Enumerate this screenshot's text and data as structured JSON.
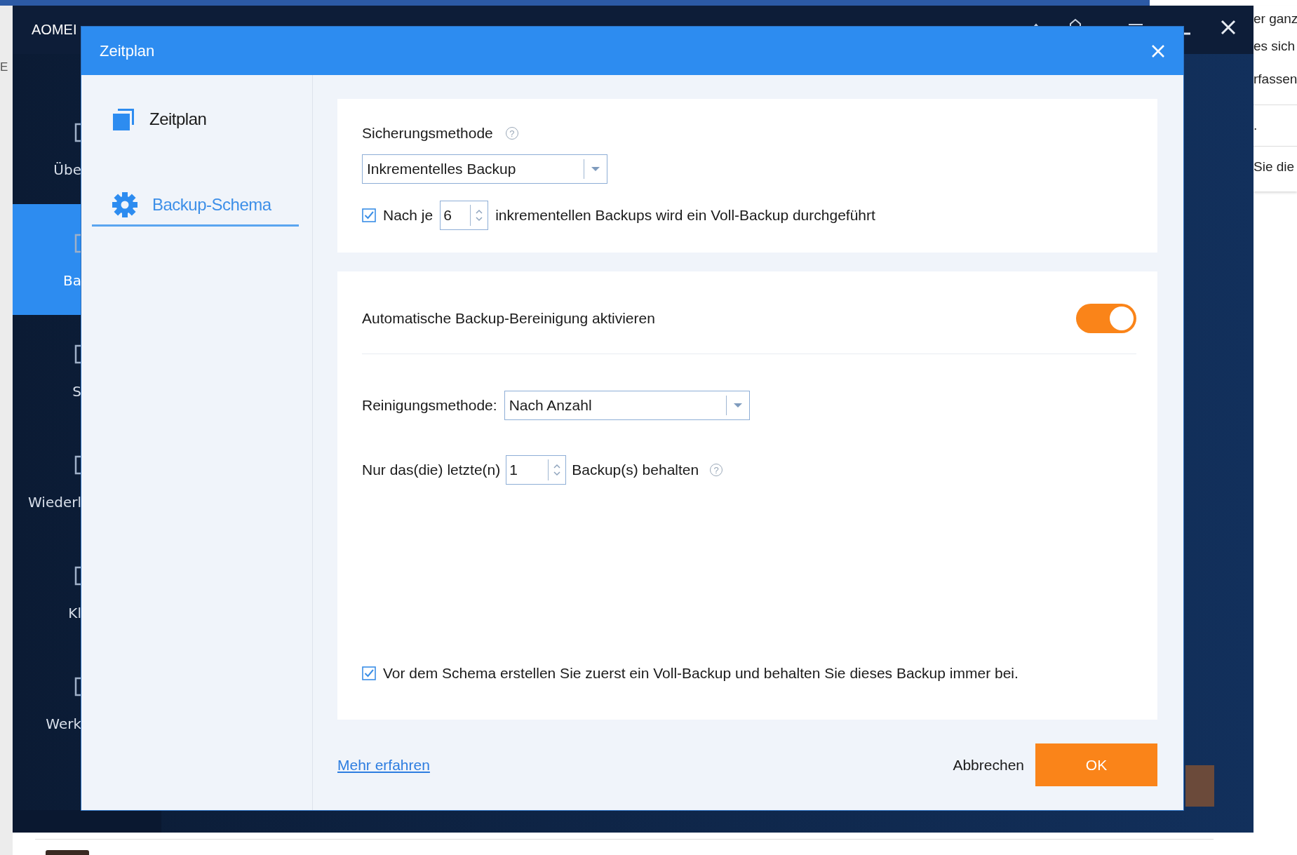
{
  "browser_page": {
    "left_text": "E",
    "right_texts": [
      "er ganz",
      "es sich",
      "rfassen",
      ".",
      "Sie die"
    ]
  },
  "app_window": {
    "title": "AOMEI",
    "nav_items": [
      {
        "label": "Übe",
        "selected": false
      },
      {
        "label": "Ba",
        "selected": true
      },
      {
        "label": "S",
        "selected": false
      },
      {
        "label": "Wiederl",
        "selected": false
      },
      {
        "label": "Kl",
        "selected": false
      },
      {
        "label": "Werk",
        "selected": false
      }
    ]
  },
  "dialog": {
    "title": "Zeitplan",
    "nav": [
      {
        "label": "Zeitplan",
        "kind": "pages",
        "selected": false
      },
      {
        "label": "Backup-Schema",
        "kind": "gear",
        "selected": true
      }
    ],
    "method": {
      "label": "Sicherungsmethode",
      "help": "?",
      "value": "Inkrementelles Backup"
    },
    "full_backup_every": {
      "checked": true,
      "prefix": "Nach je",
      "value": "6",
      "suffix": "inkrementellen Backups wird ein Voll-Backup durchgeführt"
    },
    "auto_cleanup": {
      "label": "Automatische Backup-Bereinigung aktivieren",
      "on": true
    },
    "cleanup_method": {
      "label": "Reinigungsmethode:",
      "value": "Nach Anzahl"
    },
    "keep_last": {
      "prefix": "Nur das(die) letzte(n)",
      "value": "1",
      "suffix": "Backup(s) behalten",
      "help": "?"
    },
    "keep_full": {
      "checked": true,
      "label": "Vor dem Schema erstellen Sie zuerst ein Voll-Backup und behalten Sie dieses Backup immer bei."
    },
    "learn_more": "Mehr erfahren",
    "cancel": "Abbrechen",
    "ok": "OK"
  }
}
